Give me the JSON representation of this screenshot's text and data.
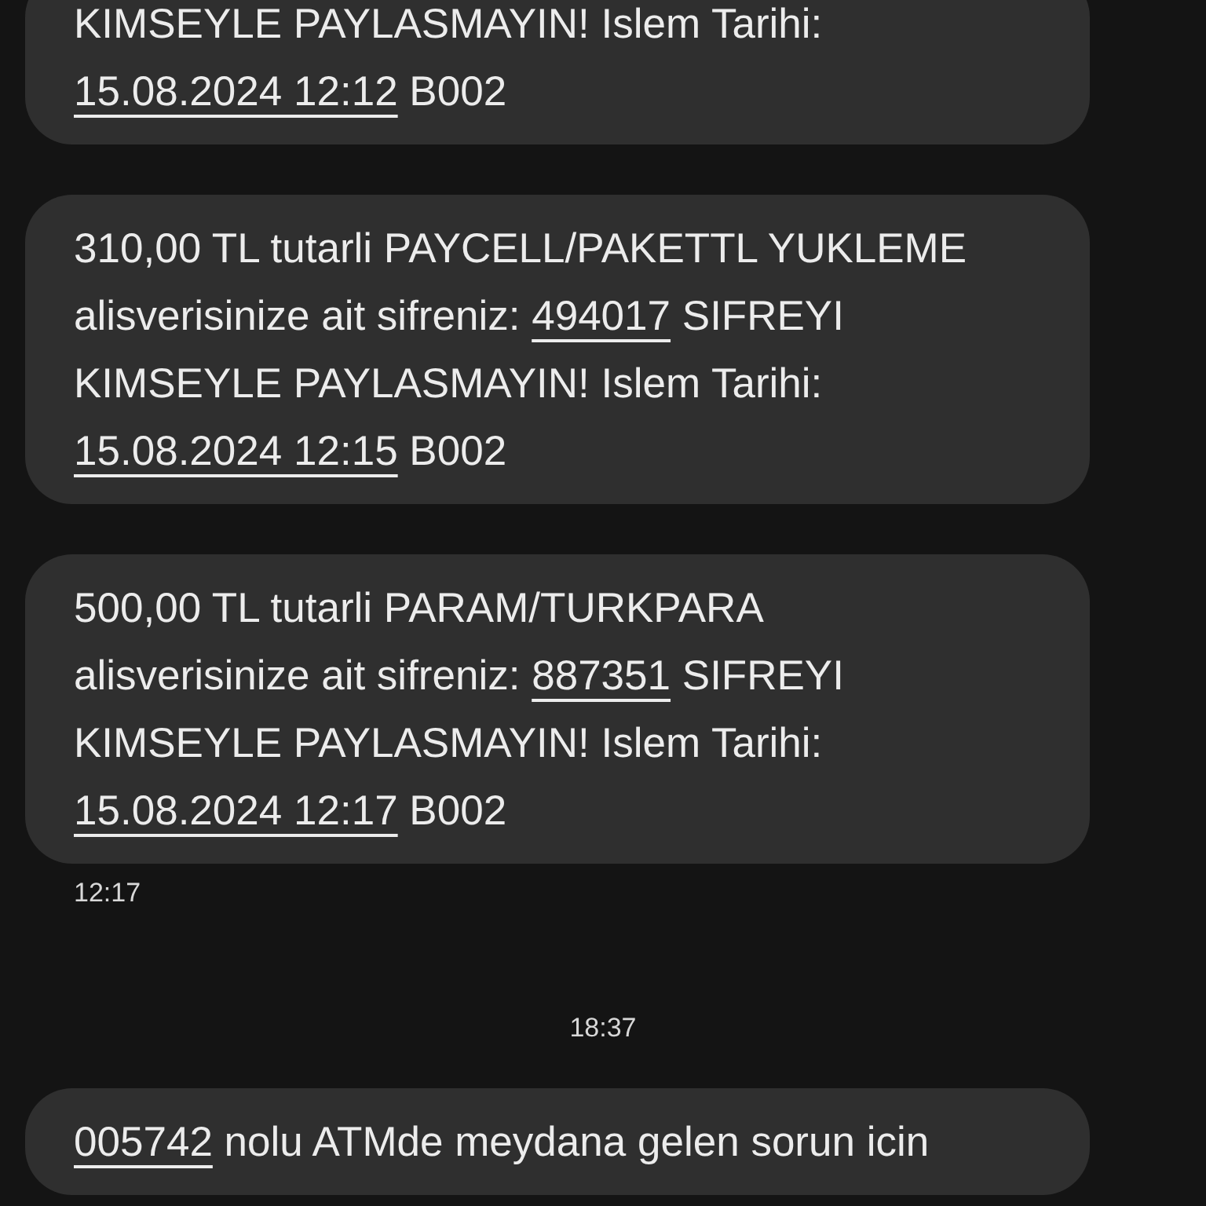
{
  "messages": [
    {
      "lines": [
        [
          {
            "text": "KIMSEYLE PAYLASMAYIN! Islem Tarihi:",
            "link": false
          }
        ],
        [
          {
            "text": "15.08.2024 12:12",
            "link": true
          },
          {
            "text": " B002",
            "link": false
          }
        ]
      ]
    },
    {
      "lines": [
        [
          {
            "text": "310,00 TL tutarli PAYCELL/PAKETTL YUKLEME",
            "link": false
          }
        ],
        [
          {
            "text": "alisverisinize ait sifreniz: ",
            "link": false
          },
          {
            "text": "494017",
            "link": true
          },
          {
            "text": " SIFREYI",
            "link": false
          }
        ],
        [
          {
            "text": "KIMSEYLE PAYLASMAYIN! Islem Tarihi:",
            "link": false
          }
        ],
        [
          {
            "text": "15.08.2024 12:15",
            "link": true
          },
          {
            "text": " B002",
            "link": false
          }
        ]
      ]
    },
    {
      "lines": [
        [
          {
            "text": "500,00 TL tutarli PARAM/TURKPARA",
            "link": false
          }
        ],
        [
          {
            "text": "alisverisinize ait sifreniz: ",
            "link": false
          },
          {
            "text": "887351",
            "link": true
          },
          {
            "text": " SIFREYI",
            "link": false
          }
        ],
        [
          {
            "text": "KIMSEYLE PAYLASMAYIN! Islem Tarihi:",
            "link": false
          }
        ],
        [
          {
            "text": "15.08.2024 12:17",
            "link": true
          },
          {
            "text": " B002",
            "link": false
          }
        ]
      ],
      "time": "12:17"
    },
    {
      "date_divider": "18:37"
    },
    {
      "lines": [
        [
          {
            "text": "005742",
            "link": true
          },
          {
            "text": " nolu ATMde meydana gelen sorun icin",
            "link": false
          }
        ]
      ]
    }
  ]
}
